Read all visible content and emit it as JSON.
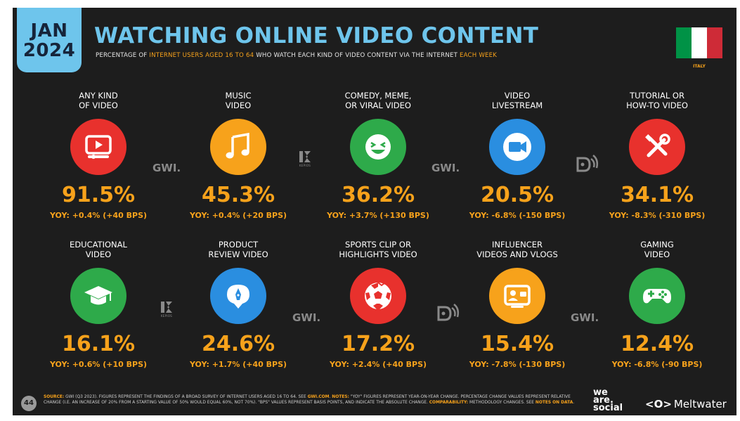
{
  "header": {
    "date_month": "JAN",
    "date_year": "2024",
    "title": "WATCHING ONLINE VIDEO CONTENT",
    "subtitle_part1": "PERCENTAGE OF ",
    "subtitle_highlight1": "INTERNET USERS AGED 16 TO 64",
    "subtitle_part2": " WHO WATCH EACH KIND OF VIDEO CONTENT VIA THE INTERNET ",
    "subtitle_highlight2": "EACH WEEK",
    "country": "ITALY",
    "flag_colors": [
      "#009246",
      "#ffffff",
      "#ce2b37"
    ]
  },
  "items": [
    {
      "label1": "ANY KIND",
      "label2": "OF VIDEO",
      "value": "91.5%",
      "yoy": "YOY: +0.4% (+40 BPS)",
      "icon": "video-player-icon",
      "color": "#e8312d"
    },
    {
      "label1": "MUSIC",
      "label2": "VIDEO",
      "value": "45.3%",
      "yoy": "YOY: +0.4% (+20 BPS)",
      "icon": "music-note-icon",
      "color": "#f7a21b"
    },
    {
      "label1": "COMEDY, MEME,",
      "label2": "OR VIRAL VIDEO",
      "value": "36.2%",
      "yoy": "YOY: +3.7% (+130 BPS)",
      "icon": "laughing-face-icon",
      "color": "#2eaa4a"
    },
    {
      "label1": "VIDEO",
      "label2": "LIVESTREAM",
      "value": "20.5%",
      "yoy": "YOY: -6.8% (-150 BPS)",
      "icon": "video-camera-icon",
      "color": "#2a8ee0"
    },
    {
      "label1": "TUTORIAL OR",
      "label2": "HOW-TO VIDEO",
      "value": "34.1%",
      "yoy": "YOY: -8.3% (-310 BPS)",
      "icon": "tools-icon",
      "color": "#e8312d"
    },
    {
      "label1": "EDUCATIONAL",
      "label2": "VIDEO",
      "value": "16.1%",
      "yoy": "YOY: +0.6% (+10 BPS)",
      "icon": "graduation-cap-icon",
      "color": "#2eaa4a"
    },
    {
      "label1": "PRODUCT",
      "label2": "REVIEW VIDEO",
      "value": "24.6%",
      "yoy": "YOY: +1.7% (+40 BPS)",
      "icon": "review-pen-icon",
      "color": "#2a8ee0"
    },
    {
      "label1": "SPORTS CLIP OR",
      "label2": "HIGHLIGHTS VIDEO",
      "value": "17.2%",
      "yoy": "YOY: +2.4% (+40 BPS)",
      "icon": "soccer-ball-icon",
      "color": "#e8312d"
    },
    {
      "label1": "INFLUENCER",
      "label2": "VIDEOS AND VLOGS",
      "value": "15.4%",
      "yoy": "YOY: -7.8% (-130 BPS)",
      "icon": "profile-card-icon",
      "color": "#f7a21b"
    },
    {
      "label1": "GAMING",
      "label2": "VIDEO",
      "value": "12.4%",
      "yoy": "YOY: -6.8% (-90 BPS)",
      "icon": "gamepad-icon",
      "color": "#2eaa4a"
    }
  ],
  "watermarks": {
    "gwi": "GWI.",
    "kepios": "KEPIOS"
  },
  "footer": {
    "page": "44",
    "source_label": "SOURCE:",
    "source_text1": " GWI (Q3 2023). FIGURES REPRESENT THE FINDINGS OF A BROAD SURVEY OF INTERNET USERS AGED 16 TO 64. SEE ",
    "source_link": "GWI.COM",
    "source_text2": ". ",
    "notes_label": "NOTES:",
    "notes_text": " \"YOY\" FIGURES REPRESENT YEAR-ON-YEAR CHANGE. PERCENTAGE CHANGE VALUES REPRESENT RELATIVE CHANGE (I.E. AN INCREASE OF 20% FROM A STARTING VALUE OF 50% WOULD EQUAL 60%, NOT 70%). \"BPS\" VALUES REPRESENT BASIS POINTS, AND INDICATE THE ABSOLUTE CHANGE. ",
    "comparability_label": "COMPARABILITY:",
    "comparability_text": " METHODOLOGY CHANGES. SEE ",
    "notes_on_data": "NOTES ON DATA",
    "end": ".",
    "brand1_line1": "we",
    "brand1_line2": "are.",
    "brand1_line3": "social",
    "brand2_logo": "<O>",
    "brand2": "Meltwater"
  }
}
